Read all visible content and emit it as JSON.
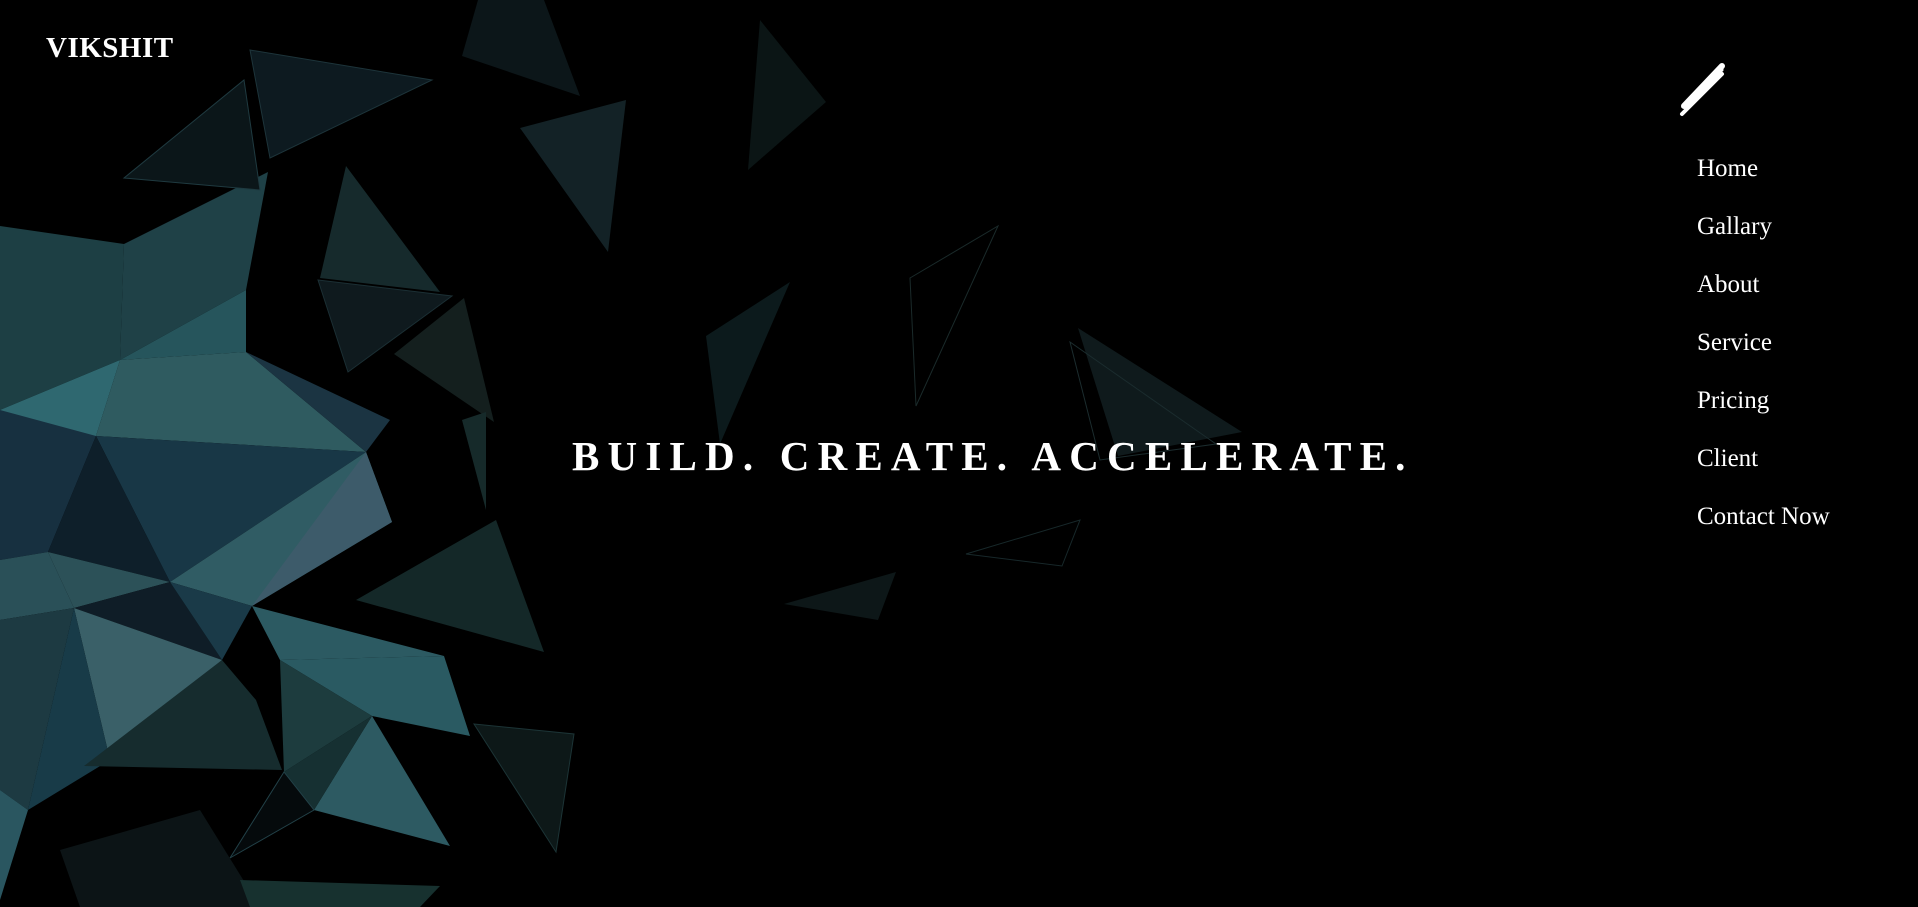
{
  "brand": {
    "logo_text": "VIKSHIT"
  },
  "hero": {
    "tagline": "BUILD. CREATE. ACCELERATE."
  },
  "menu": {
    "toggle_icon": "pencil-icon",
    "items": [
      {
        "label": "Home"
      },
      {
        "label": "Gallary"
      },
      {
        "label": "About"
      },
      {
        "label": "Service"
      },
      {
        "label": "Pricing"
      },
      {
        "label": "Client"
      },
      {
        "label": "Contact Now"
      }
    ]
  },
  "colors": {
    "background": "#000000",
    "text": "#ffffff",
    "polygon_teal": "#2f5f66",
    "polygon_dark": "#0f2530"
  }
}
